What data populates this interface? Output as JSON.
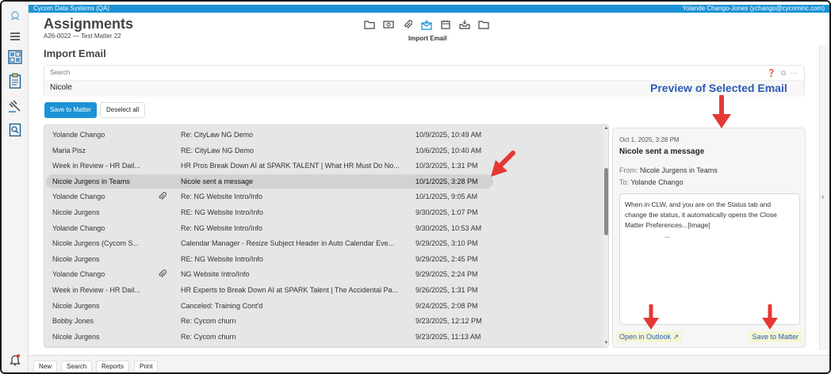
{
  "window": {
    "app_name": "Cycom Data Systems (QA)",
    "user": "Yolande Chango-Jones (ychango@cycominc.com)"
  },
  "header": {
    "title": "Assignments",
    "matter": "A26-0022 — Test Matter 22",
    "section": "Import Email",
    "active_tool_caption": "Import Email"
  },
  "toolbar": {
    "icons": [
      "folder-icon",
      "money-icon",
      "paperclip-icon",
      "import-email-icon",
      "calendar-icon",
      "inbox-icon",
      "folder-icon"
    ],
    "active_index": 3
  },
  "search": {
    "label": "Search",
    "value": "Nicole"
  },
  "annotations": {
    "preview_label": "Preview of Selected Email"
  },
  "actions": {
    "save_to_matter": "Save to Matter",
    "deselect_all": "Deselect all"
  },
  "emails": [
    {
      "from": "Yolande Chango",
      "subject": "Re: CityLaw NG Demo",
      "date": "10/9/2025, 10:49 AM",
      "attachment": false,
      "selected": false
    },
    {
      "from": "Maria Pisz",
      "subject": "RE: CityLaw NG Demo",
      "date": "10/6/2025, 10:40 AM",
      "attachment": false,
      "selected": false
    },
    {
      "from": "Week in Review - HR Dail...",
      "subject": "HR Pros Break Down AI at SPARK TALENT | What HR Must Do No...",
      "date": "10/3/2025, 1:31 PM",
      "attachment": false,
      "selected": false
    },
    {
      "from": "Nicole Jurgens in Teams",
      "subject": "Nicole sent a message",
      "date": "10/1/2025, 3:28 PM",
      "attachment": false,
      "selected": true
    },
    {
      "from": "Yolande Chango",
      "subject": "Re: NG Website Intro/Info",
      "date": "10/1/2025, 9:05 AM",
      "attachment": true,
      "selected": false
    },
    {
      "from": "Nicole Jurgens",
      "subject": "RE: NG Website Intro/Info",
      "date": "9/30/2025, 1:07 PM",
      "attachment": false,
      "selected": false
    },
    {
      "from": "Yolande Chango",
      "subject": "Re: NG Website Intro/Info",
      "date": "9/30/2025, 10:53 AM",
      "attachment": false,
      "selected": false
    },
    {
      "from": "Nicole Jurgens (Cycom S...",
      "subject": "Calendar Manager - Resize Subject Header in Auto Calendar Eve...",
      "date": "9/29/2025, 3:10 PM",
      "attachment": false,
      "selected": false
    },
    {
      "from": "Nicole Jurgens",
      "subject": "RE: NG Website Intro/Info",
      "date": "9/29/2025, 2:45 PM",
      "attachment": false,
      "selected": false
    },
    {
      "from": "Yolande Chango",
      "subject": "NG Website Intro/Info",
      "date": "9/29/2025, 2:24 PM",
      "attachment": true,
      "selected": false
    },
    {
      "from": "Week in Review - HR Dail...",
      "subject": "HR Experts to Break Down AI at SPARK Talent | The Accidental Pa...",
      "date": "9/26/2025, 1:31 PM",
      "attachment": false,
      "selected": false
    },
    {
      "from": "Nicole Jurgens",
      "subject": "Canceled: Training Cont'd",
      "date": "9/24/2025, 2:08 PM",
      "attachment": false,
      "selected": false
    },
    {
      "from": "Bobby Jones",
      "subject": "Re: Cycom churn",
      "date": "9/23/2025, 12:12 PM",
      "attachment": false,
      "selected": false
    },
    {
      "from": "Nicole Jurgens",
      "subject": "Re: Cycom churn",
      "date": "9/23/2025, 11:13 AM",
      "attachment": false,
      "selected": false
    }
  ],
  "preview": {
    "date": "Oct 1, 2025, 3:28 PM",
    "subject": "Nicole sent a message",
    "from_label": "From:",
    "from": "Nicole Jurgens in Teams",
    "to_label": "To:",
    "to": "Yolande Chango",
    "body": "When in CLW, and you are on the Status tab and change the status, it automatically opens the Close Matter Preferences...[Image]",
    "body_ellipsis": "...",
    "open_in_outlook": "Open in Outlook",
    "save_to_matter": "Save to Matter"
  },
  "bottom_bar": {
    "buttons": [
      "New",
      "Search",
      "Reports",
      "Print"
    ]
  },
  "colors": {
    "brand": "#1b93d6",
    "annotation_arrow": "#e53935",
    "annotation_text": "#2a5bb3",
    "highlight": "#f3f6d2"
  }
}
